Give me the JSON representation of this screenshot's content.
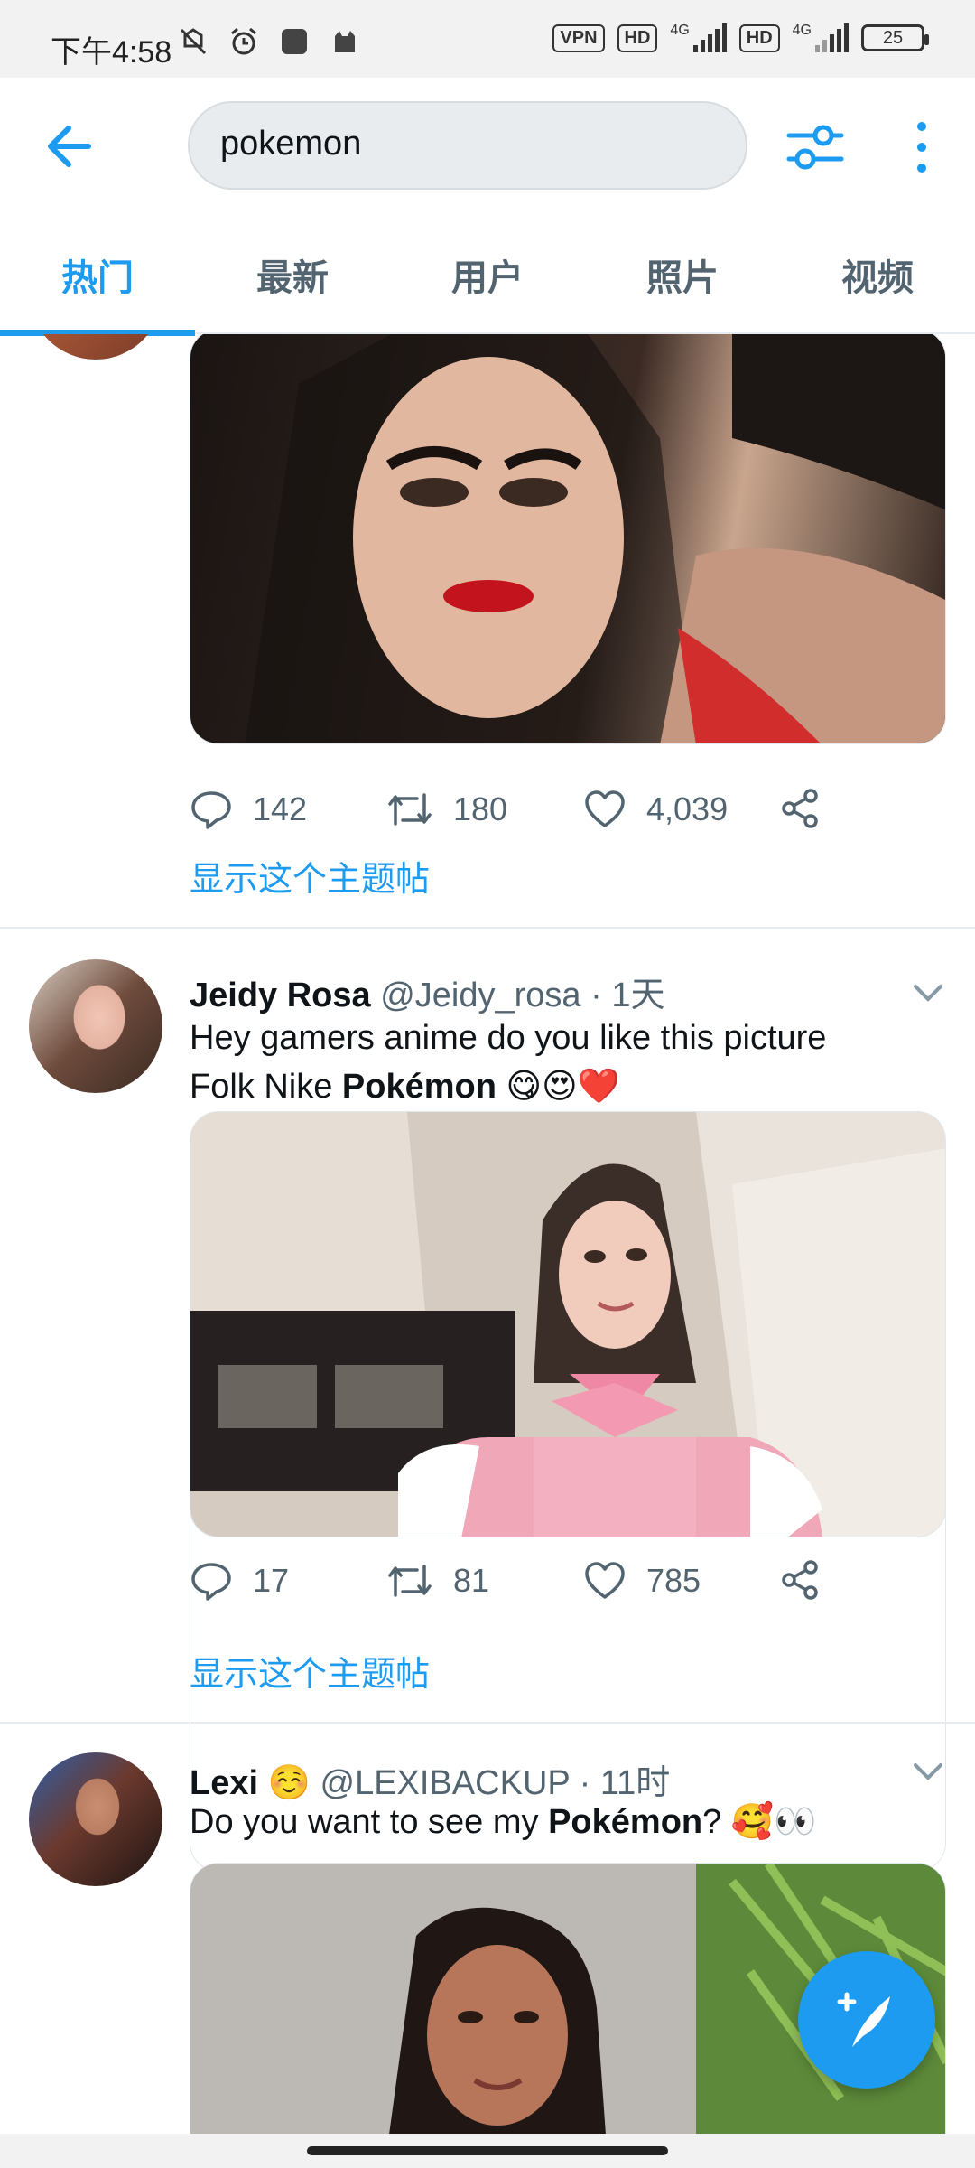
{
  "status_bar": {
    "time": "下午4:58",
    "vpn": "VPN",
    "hd1": "HD",
    "net1": "4G",
    "hd2": "HD",
    "net2": "4G",
    "battery": "25"
  },
  "search": {
    "query": "pokemon",
    "back_icon": "arrow-left-icon",
    "filter_icon": "sliders-icon",
    "more_icon": "more-vertical-icon"
  },
  "tabs": [
    {
      "label": "热门",
      "active": true
    },
    {
      "label": "最新",
      "active": false
    },
    {
      "label": "用户",
      "active": false
    },
    {
      "label": "照片",
      "active": false
    },
    {
      "label": "视频",
      "active": false
    }
  ],
  "tweets": [
    {
      "replies": "142",
      "retweets": "180",
      "likes": "4,039",
      "show_thread": "显示这个主题帖"
    },
    {
      "name": "Jeidy Rosa",
      "handle": "@Jeidy_rosa",
      "dot": "·",
      "time": "1天",
      "text_line1": "Hey gamers anime do you like this picture",
      "text_line2_plain": "Folk Nike ",
      "text_line2_bold": "Pokémon",
      "text_line2_emoji": " 😋😍❤️",
      "replies": "17",
      "retweets": "81",
      "likes": "785",
      "show_thread": "显示这个主题帖"
    },
    {
      "name": "Lexi",
      "name_emoji": "☺️",
      "handle": "@LEXIBACKUP",
      "dot": "·",
      "time": "11时",
      "text_plain": "Do you want to see my ",
      "text_bold": "Pokémon",
      "text_after": "? 🥰👀"
    }
  ],
  "colors": {
    "accent": "#1d9bf0",
    "muted": "#536471",
    "text": "#0f1419"
  }
}
